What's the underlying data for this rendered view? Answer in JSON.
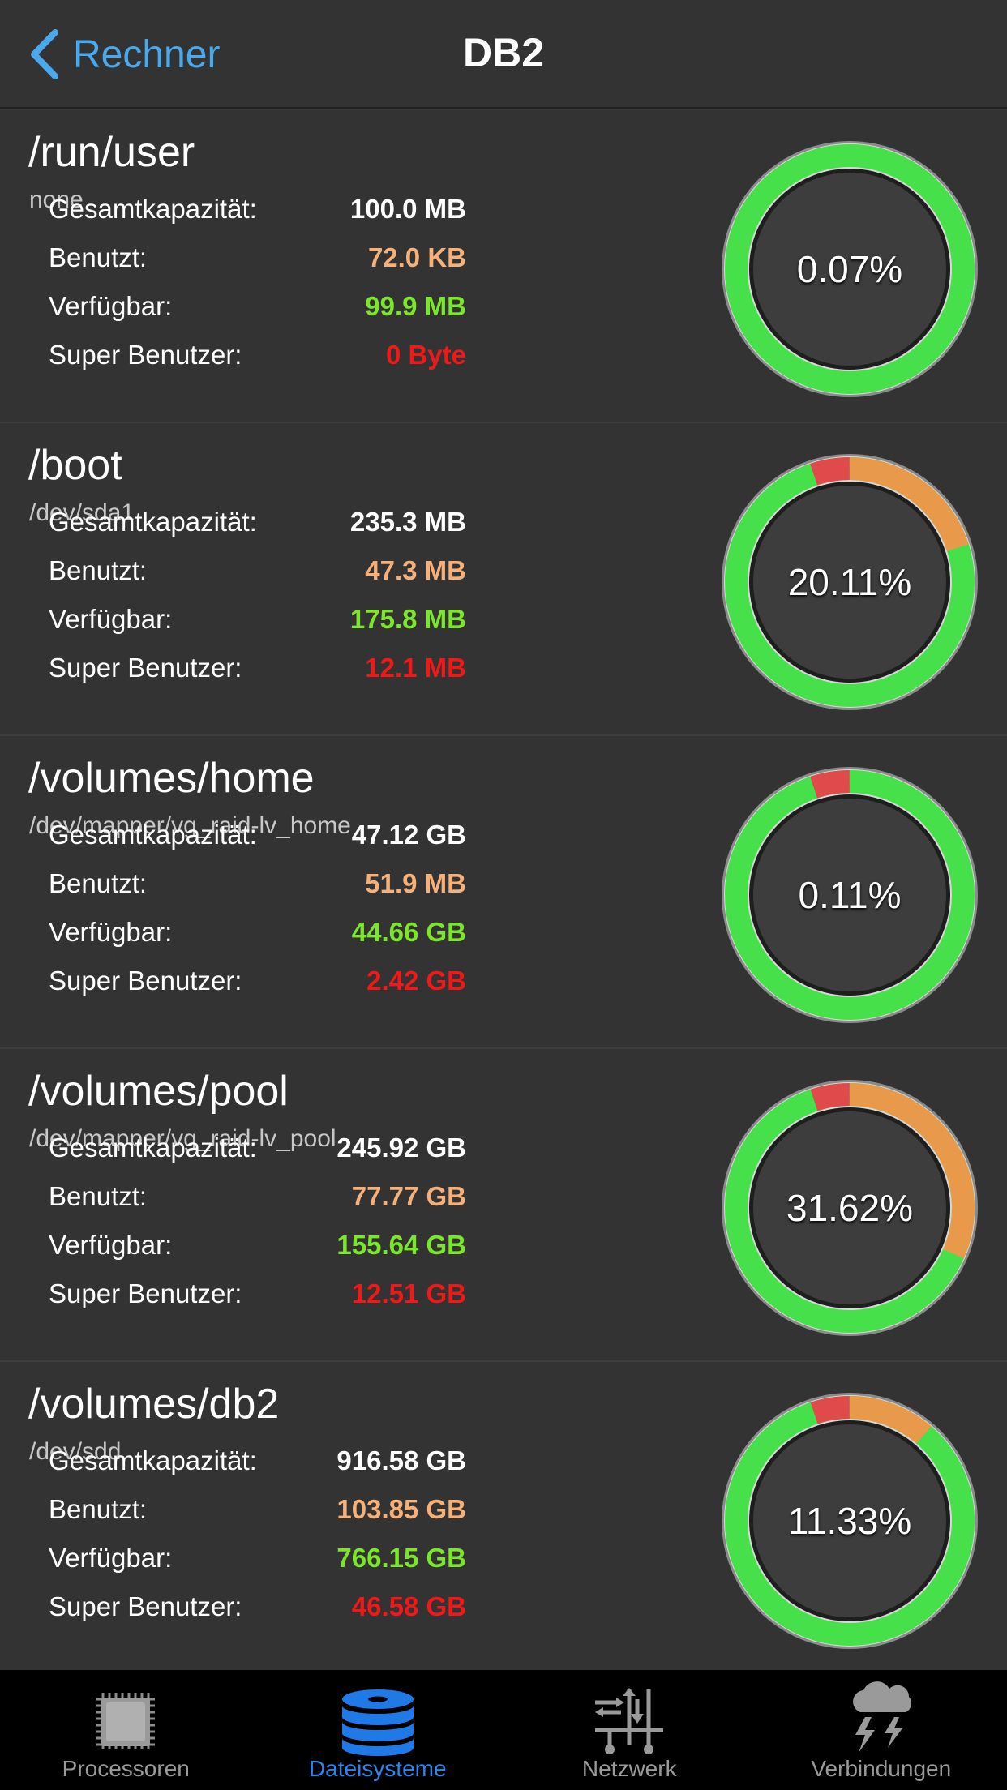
{
  "nav": {
    "back_label": "Rechner",
    "title": "DB2"
  },
  "colors": {
    "accent": "#4aa8ec",
    "total": "#ffffff",
    "used": "#f6b07a",
    "available": "#7ce62a",
    "super": "#f01818",
    "gauge_green": "#46e04a",
    "gauge_orange": "#e89a4a",
    "gauge_red": "#e04a4a",
    "tab_active": "#2a86ee"
  },
  "labels": {
    "total": "Gesamtkapazität:",
    "used": "Benutzt:",
    "available": "Verfügbar:",
    "super": "Super Benutzer:"
  },
  "filesystems": [
    {
      "name": "/run/user",
      "device": "none",
      "total": "100.0 MB",
      "used": "72.0 KB",
      "available": "99.9 MB",
      "super": "0 Byte",
      "percent": "0.07%",
      "used_fraction": 0.0007,
      "super_fraction": 0.0
    },
    {
      "name": "/boot",
      "device": "/dev/sda1",
      "total": "235.3 MB",
      "used": "47.3 MB",
      "available": "175.8 MB",
      "super": "12.1 MB",
      "percent": "20.11%",
      "used_fraction": 0.2011,
      "super_fraction": 0.0514
    },
    {
      "name": "/volumes/home",
      "device": "/dev/mapper/vg_raid-lv_home",
      "total": "47.12 GB",
      "used": "51.9 MB",
      "available": "44.66 GB",
      "super": "2.42 GB",
      "percent": "0.11%",
      "used_fraction": 0.0011,
      "super_fraction": 0.0514
    },
    {
      "name": "/volumes/pool",
      "device": "/dev/mapper/vg_raid-lv_pool",
      "total": "245.92 GB",
      "used": "77.77 GB",
      "available": "155.64 GB",
      "super": "12.51 GB",
      "percent": "31.62%",
      "used_fraction": 0.3162,
      "super_fraction": 0.0509
    },
    {
      "name": "/volumes/db2",
      "device": "/dev/sdd",
      "total": "916.58 GB",
      "used": "103.85 GB",
      "available": "766.15 GB",
      "super": "46.58 GB",
      "percent": "11.33%",
      "used_fraction": 0.1133,
      "super_fraction": 0.0508
    }
  ],
  "tabs": [
    {
      "label": "Processoren",
      "icon": "cpu-icon",
      "active": false
    },
    {
      "label": "Dateisysteme",
      "icon": "database-icon",
      "active": true
    },
    {
      "label": "Netzwerk",
      "icon": "network-icon",
      "active": false
    },
    {
      "label": "Verbindungen",
      "icon": "storm-cloud-icon",
      "active": false
    }
  ]
}
